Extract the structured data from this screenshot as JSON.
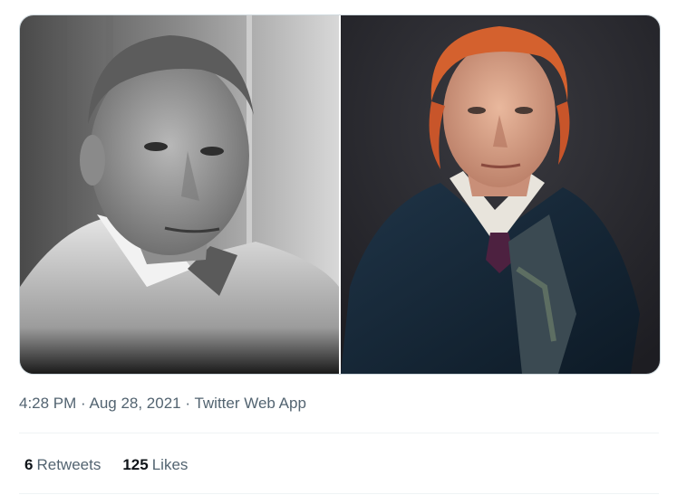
{
  "tweet": {
    "time": "4:28 PM",
    "separator1": " · ",
    "date": "Aug 28, 2021",
    "separator2": " · ",
    "source": "Twitter Web App"
  },
  "stats": {
    "retweets_count": "6",
    "retweets_label": "Retweets",
    "likes_count": "125",
    "likes_label": "Likes"
  },
  "media": {
    "left_photo": "grayscale-portrait-man",
    "right_photo": "color-portrait-red-haired-man"
  }
}
